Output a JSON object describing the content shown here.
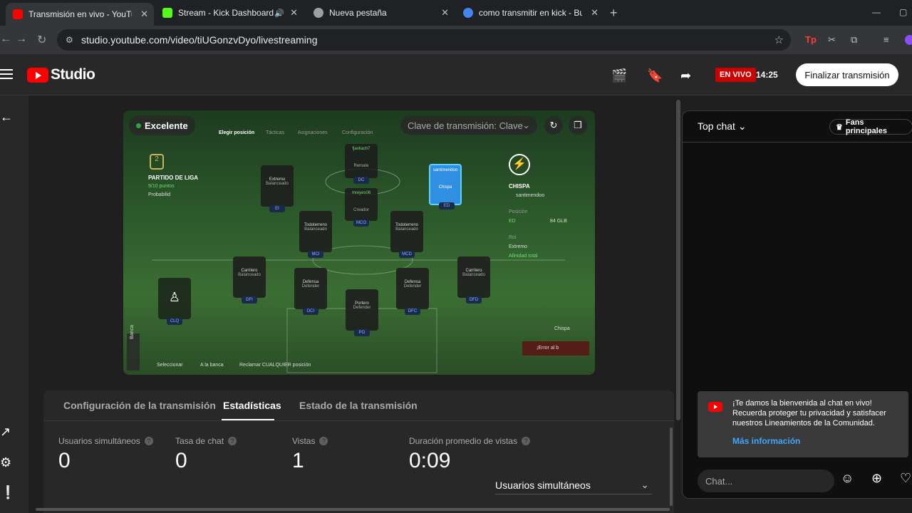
{
  "browser": {
    "tabs": [
      {
        "title": "Transmisión en vivo - YouTube",
        "favicon_color": "#ff0000"
      },
      {
        "title": "Stream - Kick Dashboard",
        "favicon_color": "#53fc18"
      },
      {
        "title": "Nueva pestaña",
        "favicon_color": "#9aa0a6"
      },
      {
        "title": "como transmitir en kick - Busca",
        "favicon_color": "#4285f4"
      }
    ],
    "url": "studio.youtube.com/video/tiUGonzvDyo/livestreaming"
  },
  "header": {
    "logo_text": "Studio",
    "live_badge": "EN VIVO",
    "live_time": "14:25",
    "end_button": "Finalizar transmisión"
  },
  "preview": {
    "quality_badge": "Excelente",
    "stream_key_label": "Clave de transmisión: Clave",
    "game_hud": {
      "menu": [
        "Elegir posición",
        "Tácticas",
        "Asignaciones",
        "Configuración"
      ],
      "league_title": "PARTIDO DE LIGA",
      "league_points": "9/10 puntos",
      "probability_label": "Probabilid",
      "player_title": "CHISPA",
      "player_name": "santimendoo",
      "position_label": "Posición",
      "position_value": "ED",
      "glb": "84 GLB",
      "role_label": "Rol",
      "role_value": "Extremo",
      "affinity": "Afinidad total",
      "bench_label": "Banca",
      "footer": [
        "Seleccionar",
        "A la banca",
        "Reclamar CUALQUIER posición"
      ],
      "error_label": "¡Error al b",
      "chispa_label": "Chispa",
      "cards": [
        {
          "name": "Extremo",
          "role": "Balanceado",
          "pos": "EI"
        },
        {
          "name": "fjavliach7",
          "role": "Remate",
          "pos": "DC"
        },
        {
          "name": "santimendoo",
          "role": "Chispa",
          "pos": "ED"
        },
        {
          "name": "mreyes06",
          "role": "Creador",
          "pos": "MCO"
        },
        {
          "name": "Todoterreno",
          "role": "Balanceado",
          "pos": "MCI"
        },
        {
          "name": "Todoterreno",
          "role": "Balanceado",
          "pos": "MCD"
        },
        {
          "name": "Carrilero",
          "role": "Balanceado",
          "pos": "DFI"
        },
        {
          "name": "Defensa",
          "role": "Defender",
          "pos": "DCI"
        },
        {
          "name": "Defensa",
          "role": "Defender",
          "pos": "DFC"
        },
        {
          "name": "Carrilero",
          "role": "Balanceado",
          "pos": "DFD"
        },
        {
          "name": "Portero",
          "role": "Defender",
          "pos": "PO"
        }
      ],
      "bench_pos": "CLQ"
    }
  },
  "tabs": {
    "items": [
      "Configuración de la transmisión",
      "Estadísticas",
      "Estado de la transmisión"
    ],
    "active": "Estadísticas"
  },
  "stats": [
    {
      "label": "Usuarios simultáneos",
      "value": "0"
    },
    {
      "label": "Tasa de chat",
      "value": "0"
    },
    {
      "label": "Vistas",
      "value": "1"
    },
    {
      "label": "Duración promedio de vistas",
      "value": "0:09"
    }
  ],
  "metric_select": "Usuarios simultáneos",
  "chat": {
    "title": "Top chat",
    "fans_button": "Fans principales",
    "welcome": "¡Te damos la bienvenida al chat en vivo! Recuerda proteger tu privacidad y satisfacer nuestros Lineamientos de la Comunidad.",
    "more_info": "Más información",
    "input_placeholder": "Chat..."
  }
}
